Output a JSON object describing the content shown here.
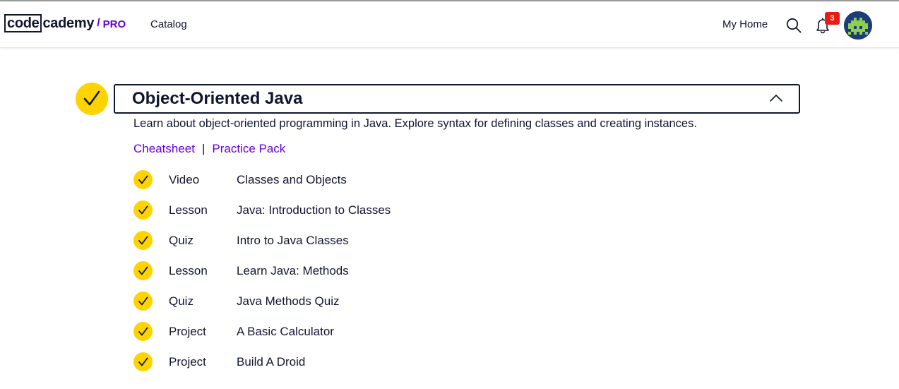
{
  "navbar": {
    "logo_code": "code",
    "logo_cademy": "cademy",
    "logo_slash": "/",
    "logo_pro": "PRO",
    "catalog_label": "Catalog",
    "my_home_label": "My Home",
    "notification_count": "3",
    "icons": [
      "search-icon",
      "bell-icon",
      "avatar"
    ],
    "colors": {
      "brand_purple": "#6400e4",
      "badge_red": "#e91c11",
      "navy": "#10162f"
    }
  },
  "module": {
    "title": "Object-Oriented Java",
    "description": "Learn about object-oriented programming in Java. Explore syntax for defining classes and creating instances.",
    "completed": true,
    "expanded": true,
    "cheatsheet_label": "Cheatsheet",
    "separator": "|",
    "practice_pack_label": "Practice Pack",
    "check_color": "#ffd300",
    "items": [
      {
        "type": "Video",
        "name": "Classes and Objects",
        "completed": true
      },
      {
        "type": "Lesson",
        "name": "Java: Introduction to Classes",
        "completed": true
      },
      {
        "type": "Quiz",
        "name": "Intro to Java Classes",
        "completed": true
      },
      {
        "type": "Lesson",
        "name": "Learn Java: Methods",
        "completed": true
      },
      {
        "type": "Quiz",
        "name": "Java Methods Quiz",
        "completed": true
      },
      {
        "type": "Project",
        "name": "A Basic Calculator",
        "completed": true
      },
      {
        "type": "Project",
        "name": "Build A Droid",
        "completed": true
      }
    ]
  }
}
